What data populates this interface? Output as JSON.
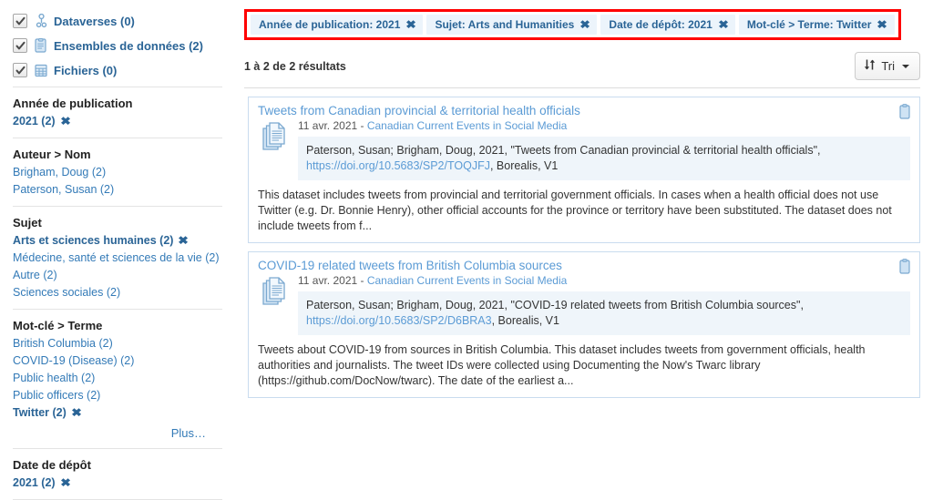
{
  "sidebar": {
    "types": [
      {
        "label": "Dataverses (0)",
        "icon": "dataverse-icon",
        "checked": true
      },
      {
        "label": "Ensembles de données (2)",
        "icon": "dataset-icon",
        "checked": true
      },
      {
        "label": "Fichiers (0)",
        "icon": "file-icon",
        "checked": true
      }
    ],
    "facets": [
      {
        "heading": "Année de publication",
        "items": [
          {
            "label": "2021 (2)",
            "selected": true,
            "clear": "✖"
          }
        ]
      },
      {
        "heading": "Auteur > Nom",
        "items": [
          {
            "label": "Brigham, Doug (2)",
            "selected": false
          },
          {
            "label": "Paterson, Susan (2)",
            "selected": false
          }
        ]
      },
      {
        "heading": "Sujet",
        "items": [
          {
            "label": "Arts et sciences humaines (2)",
            "selected": true,
            "clear": "✖"
          },
          {
            "label": "Médecine, santé et sciences de la vie (2)",
            "selected": false
          },
          {
            "label": "Autre (2)",
            "selected": false
          },
          {
            "label": "Sciences sociales (2)",
            "selected": false
          }
        ]
      },
      {
        "heading": "Mot-clé > Terme",
        "items": [
          {
            "label": "British Columbia (2)",
            "selected": false
          },
          {
            "label": "COVID-19 (Disease) (2)",
            "selected": false
          },
          {
            "label": "Public health (2)",
            "selected": false
          },
          {
            "label": "Public officers (2)",
            "selected": false
          },
          {
            "label": "Twitter (2)",
            "selected": true,
            "clear": "✖"
          }
        ],
        "more_label": "Plus…"
      },
      {
        "heading": "Date de dépôt",
        "items": [
          {
            "label": "2021 (2)",
            "selected": true,
            "clear": "✖"
          }
        ]
      }
    ]
  },
  "filters": {
    "highlight_color": "#ff0000",
    "pills": [
      {
        "label": "Année de publication: 2021",
        "remove": "✖"
      },
      {
        "label": "Sujet: Arts and Humanities",
        "remove": "✖"
      },
      {
        "label": "Date de dépôt: 2021",
        "remove": "✖"
      },
      {
        "label": "Mot-clé > Terme: Twitter",
        "remove": "✖"
      }
    ]
  },
  "results_header": {
    "count_text": "1 à 2 de 2 résultats",
    "sort_label": "Tri"
  },
  "results": [
    {
      "title": "Tweets from Canadian provincial & territorial health officials",
      "date": "11 avr. 2021",
      "separator": " - ",
      "dataverse": "Canadian Current Events in Social Media",
      "citation_prefix": "Paterson, Susan; Brigham, Doug, 2021, \"Tweets from Canadian provincial & territorial health officials\", ",
      "citation_doi": "https://doi.org/10.5683/SP2/TOQJFJ",
      "citation_suffix": ", Borealis, V1",
      "description": "This dataset includes tweets from provincial and territorial government officials. In cases when a health official does not use Twitter (e.g. Dr. Bonnie Henry), other official accounts for the province or territory have been substituted. The dataset does not include tweets from f..."
    },
    {
      "title": "COVID-19 related tweets from British Columbia sources",
      "date": "11 avr. 2021",
      "separator": " - ",
      "dataverse": "Canadian Current Events in Social Media",
      "citation_prefix": "Paterson, Susan; Brigham, Doug, 2021, \"COVID-19 related tweets from British Columbia sources\", ",
      "citation_doi": "https://doi.org/10.5683/SP2/D6BRA3",
      "citation_suffix": ", Borealis, V1",
      "description": "Tweets about COVID-19 from sources in British Columbia. This dataset includes tweets from government officials, health authorities and journalists. The tweet IDs were collected using Documenting the Now's Twarc library (https://github.com/DocNow/twarc). The date of the earliest a..."
    }
  ],
  "colors": {
    "link": "#337ab7",
    "title_link": "#5b9bd5",
    "pill_bg": "#ecf4fb",
    "citation_bg": "#eff5fa",
    "card_border": "#c9dcef"
  }
}
